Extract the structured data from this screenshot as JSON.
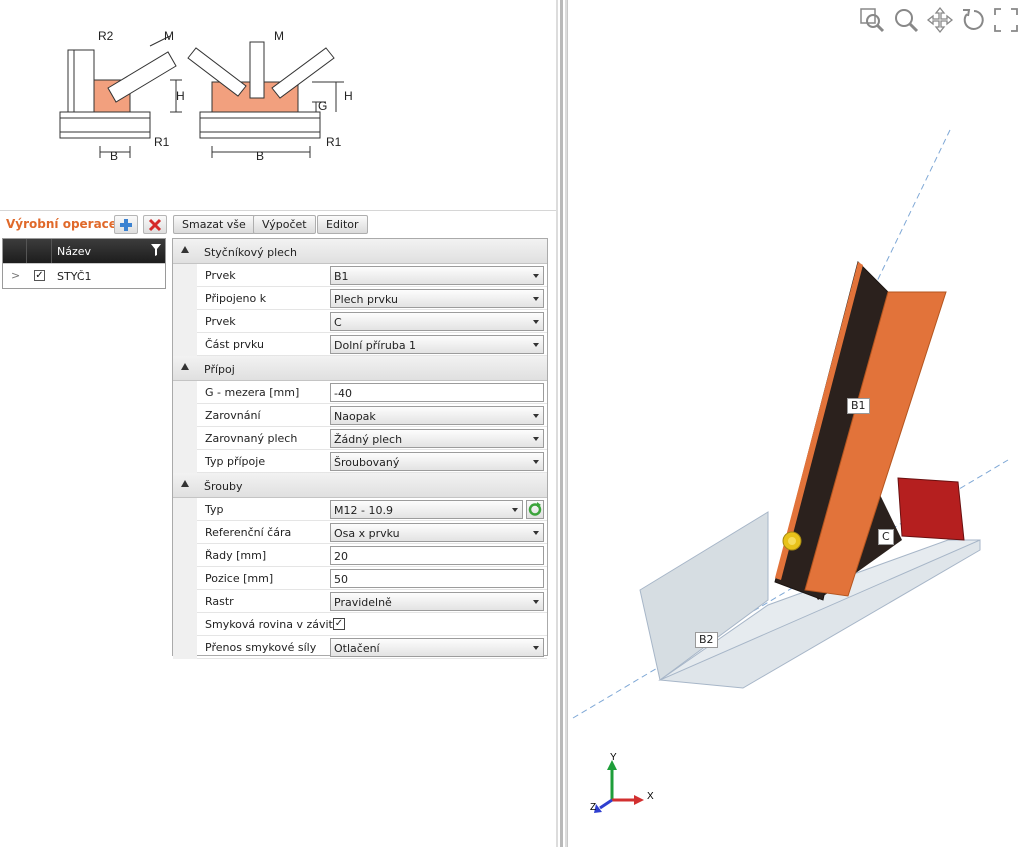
{
  "schema": {
    "left_labels": {
      "r2": "R2",
      "m": "M",
      "h": "H",
      "b": "B",
      "r1": "R1"
    },
    "right_labels": {
      "m": "M",
      "g": "G",
      "h": "H",
      "b": "B",
      "r1": "R1"
    }
  },
  "toolbar": {
    "title": "Výrobní operace",
    "delete_all": "Smazat vše",
    "calculate": "Výpočet",
    "editor": "Editor"
  },
  "operations": {
    "header_name": "Název",
    "rows": [
      {
        "checked": true,
        "name": "STYČ1"
      }
    ]
  },
  "properties": {
    "sections": [
      {
        "title": "Styčníkový plech",
        "rows": [
          {
            "label": "Prvek",
            "value": "B1",
            "type": "dropdown"
          },
          {
            "label": "Připojeno k",
            "value": "Plech prvku",
            "type": "dropdown"
          },
          {
            "label": "Prvek",
            "value": "C",
            "type": "dropdown"
          },
          {
            "label": "Část prvku",
            "value": "Dolní příruba 1",
            "type": "dropdown"
          }
        ]
      },
      {
        "title": "Přípoj",
        "rows": [
          {
            "label": "G - mezera [mm]",
            "value": "-40",
            "type": "text"
          },
          {
            "label": "Zarovnání",
            "value": "Naopak",
            "type": "dropdown"
          },
          {
            "label": "Zarovnaný plech",
            "value": "Žádný plech",
            "type": "dropdown"
          },
          {
            "label": "Typ přípoje",
            "value": "Šroubovaný",
            "type": "dropdown"
          }
        ]
      },
      {
        "title": "Šrouby",
        "rows": [
          {
            "label": "Typ",
            "value": "M12 - 10.9",
            "type": "dropdown-refresh"
          },
          {
            "label": "Referenční čára",
            "value": "Osa x prvku",
            "type": "dropdown"
          },
          {
            "label": "Řady [mm]",
            "value": "20",
            "type": "text"
          },
          {
            "label": "Pozice [mm]",
            "value": "50",
            "type": "text"
          },
          {
            "label": "Rastr",
            "value": "Pravidelně",
            "type": "dropdown"
          },
          {
            "label": "Smyková rovina v závitu",
            "value": "",
            "checked": true,
            "type": "checkbox"
          },
          {
            "label": "Přenos smykové síly",
            "value": "Otlačení",
            "type": "dropdown"
          }
        ]
      }
    ]
  },
  "viewport": {
    "tools": [
      "zoom-window-icon",
      "zoom-icon",
      "pan-icon",
      "rotate-icon",
      "fit-icon"
    ],
    "members": {
      "b1": "B1",
      "b2": "B2",
      "c": "C"
    },
    "axes": {
      "x": "X",
      "y": "Y",
      "z": "Z"
    },
    "colors": {
      "beam_face": "#e2733a",
      "beam_web": "#2b211d",
      "plate": "#b51f1f",
      "base": "#d6dde2",
      "bolt": "#e8c21a",
      "accent": "#e0692a"
    }
  }
}
